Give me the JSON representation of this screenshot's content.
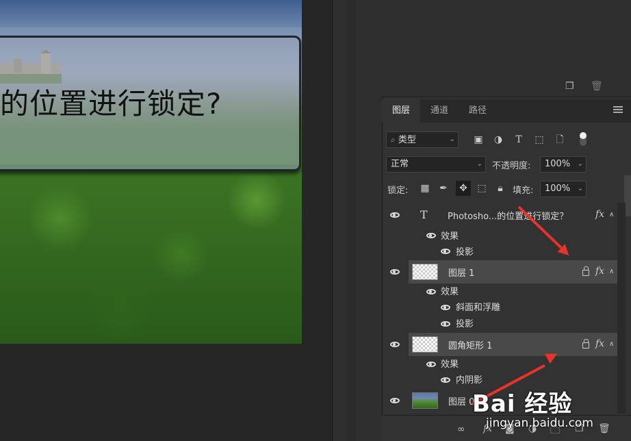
{
  "canvas": {
    "banner_text": "的位置进行锁定?"
  },
  "tabs": {
    "layers": "图层",
    "channels": "通道",
    "paths": "路径"
  },
  "filter": {
    "kind_label": "类型"
  },
  "blend": {
    "mode": "正常",
    "opacity_label": "不透明度:",
    "opacity_value": "100%",
    "lock_label": "锁定:",
    "fill_label": "填充:",
    "fill_value": "100%"
  },
  "layers": [
    {
      "name": "Photosho...的位置进行锁定？",
      "type": "text",
      "fx": "fx",
      "effects_label": "效果",
      "effects": [
        "投影"
      ]
    },
    {
      "name": "图层 1",
      "type": "pixel",
      "fx": "fx",
      "locked": true,
      "effects_label": "效果",
      "effects": [
        "斜面和浮雕",
        "投影"
      ]
    },
    {
      "name": "圆角矩形 1",
      "type": "shape",
      "fx": "fx",
      "locked": true,
      "effects_label": "效果",
      "effects": [
        "内阴影"
      ]
    },
    {
      "name": "图层 0",
      "type": "image"
    }
  ],
  "watermark": {
    "brand": "Bai 经验",
    "url": "jingyan.baidu.com"
  },
  "colors": {
    "panel_bg": "#323232",
    "selected_row": "#494949",
    "annotation_arrow": "#e8332a"
  }
}
